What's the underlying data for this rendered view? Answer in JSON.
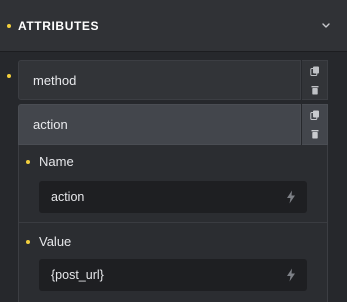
{
  "panel": {
    "title": "ATTRIBUTES",
    "chevron_icon": "chevron-down-icon"
  },
  "attributes": [
    {
      "label": "method",
      "active": false
    },
    {
      "label": "action",
      "active": true
    }
  ],
  "expanded": {
    "fields": [
      {
        "label": "Name",
        "value": "action",
        "dynamic_icon": "bolt-icon"
      },
      {
        "label": "Value",
        "value": "{post_url}",
        "dynamic_icon": "bolt-icon"
      }
    ]
  },
  "colors": {
    "accent_dot": "#f2cf3d",
    "panel_bg": "#303236",
    "input_bg": "#1e1f22"
  }
}
